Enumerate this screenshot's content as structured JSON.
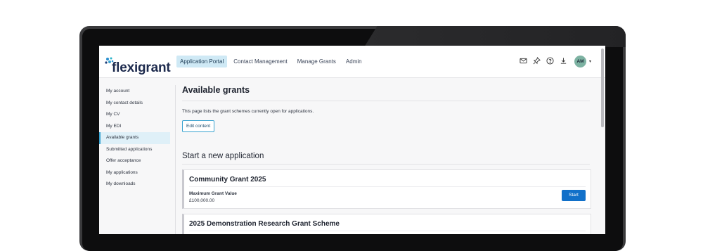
{
  "app": {
    "logo_text": "flexigrant"
  },
  "nav": {
    "items": [
      {
        "label": "Application Portal",
        "active": true
      },
      {
        "label": "Contact Management",
        "active": false
      },
      {
        "label": "Manage Grants",
        "active": false
      },
      {
        "label": "Admin",
        "active": false
      }
    ]
  },
  "header_icons": [
    "mail-icon",
    "pin-icon",
    "help-icon",
    "download-icon"
  ],
  "user": {
    "initials": "AM",
    "caret": "▾"
  },
  "sidebar": {
    "items": [
      {
        "label": "My account",
        "active": false
      },
      {
        "label": "My contact details",
        "active": false
      },
      {
        "label": "My CV",
        "active": false
      },
      {
        "label": "My EDI",
        "active": false
      },
      {
        "label": "Available grants",
        "active": true
      },
      {
        "label": "Submitted applications",
        "active": false
      },
      {
        "label": "Offer acceptance",
        "active": false
      },
      {
        "label": "My applications",
        "active": false
      },
      {
        "label": "My downloads",
        "active": false
      }
    ]
  },
  "main": {
    "title": "Available grants",
    "description": "This page lists the grant schemes currently open for applications.",
    "edit_button": "Edit content",
    "section_title": "Start a new application",
    "grants": [
      {
        "title": "Community Grant 2025",
        "label": "Maximum Grant Value",
        "value": "£100,000.00",
        "button": "Start"
      },
      {
        "title": "2025 Demonstration Research Grant Scheme"
      }
    ]
  },
  "colors": {
    "brand": "#1d2a4d",
    "accent": "#3aa3d0",
    "primary_button": "#1170c9",
    "nav_active_bg": "#cfe9f5",
    "avatar": "#7db2a2"
  }
}
